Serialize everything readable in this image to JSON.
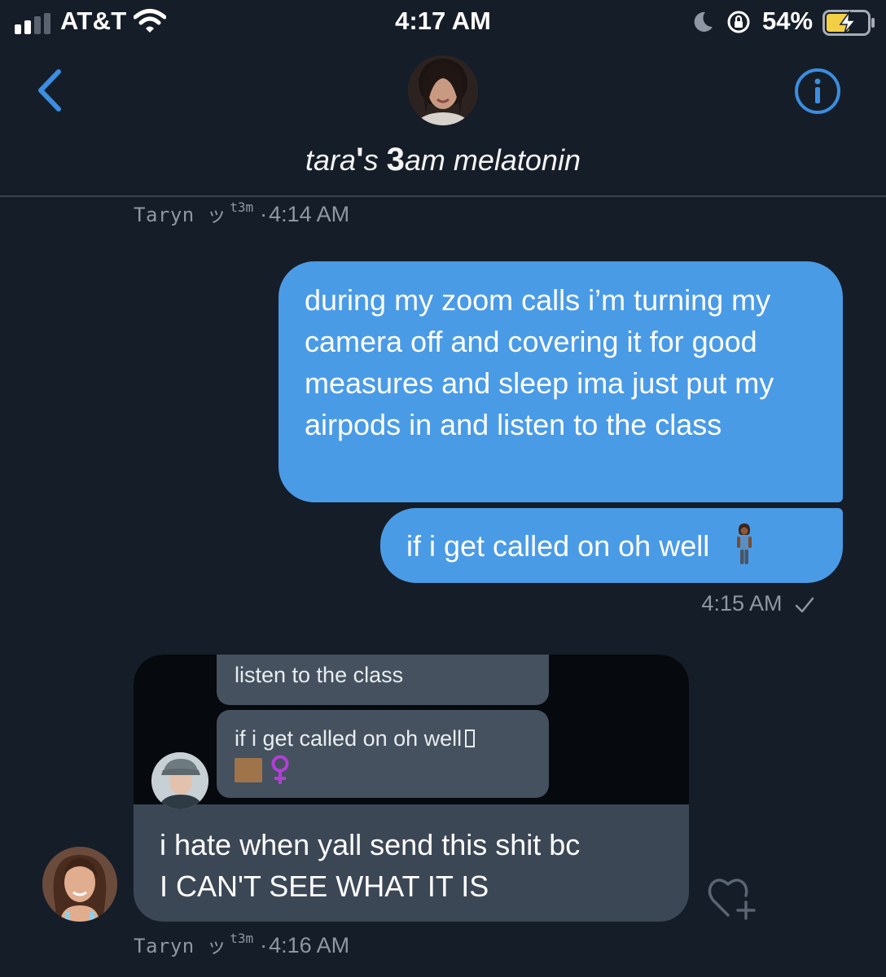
{
  "status_bar": {
    "carrier": "AT&T",
    "time": "4:17 AM",
    "battery_percent": "54%",
    "signal_bars": 2,
    "battery_level": 0.54,
    "charging": true
  },
  "header": {
    "title_pre": "tara",
    "title_apos": "'",
    "title_s": "s ",
    "title_bold": "3",
    "title_post": "am melatonin"
  },
  "meta_top": {
    "name": "Taryn ッ",
    "sup": "t3m",
    "dot": "·",
    "time": "4:14 AM"
  },
  "messages_out": {
    "bubble1": "during my zoom calls i’m turning my camera off and covering it for good measures and sleep ima just put my airpods in and listen to the class",
    "bubble2": "if i get called on oh well",
    "emoji": "woman-standing-emoji",
    "time": "4:15 AM"
  },
  "incoming": {
    "screenshot": {
      "line1": "listen to the class",
      "line2": "if i get called on oh well"
    },
    "text_line1": "i hate when yall send this shit bc",
    "text_line2": "I CAN'T SEE WHAT IT IS"
  },
  "meta_bottom": {
    "name": "Taryn ッ",
    "sup": "t3m",
    "dot": "·",
    "time": "4:16 AM"
  },
  "colors": {
    "background": "#151d28",
    "outgoing_bubble": "#4a9be6",
    "incoming_bubble": "#3c4756",
    "accent": "#3b8ee0",
    "meta_text": "#8e97a3"
  },
  "icons": {
    "back": "chevron-left-icon",
    "info": "info-icon",
    "react": "heart-plus-icon",
    "read": "checkmark-icon"
  }
}
